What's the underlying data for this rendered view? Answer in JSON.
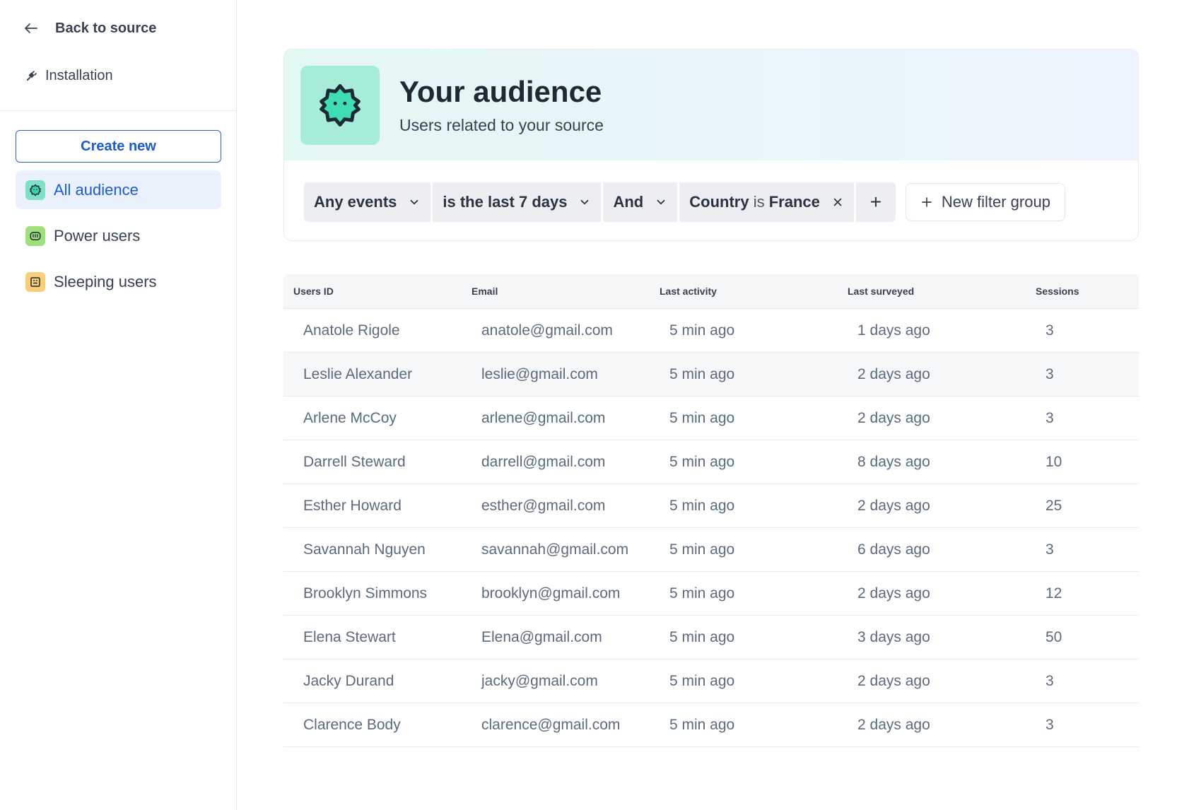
{
  "sidebar": {
    "back_label": "Back to source",
    "installation_label": "Installation",
    "create_label": "Create new",
    "items": [
      {
        "label": "All audience",
        "icon": "badge-icon",
        "color": "#7ee0c4"
      },
      {
        "label": "Power users",
        "icon": "face-icon",
        "color": "#9fe07d"
      },
      {
        "label": "Sleeping users",
        "icon": "box-icon",
        "color": "#f9cf7a"
      }
    ]
  },
  "header": {
    "title": "Your audience",
    "subtitle": "Users related to your source",
    "accent": "#a6ecd9"
  },
  "filters": {
    "events": "Any events",
    "period": "is the last 7 days",
    "operator": "And",
    "condition_field": "Country",
    "condition_op": "is",
    "condition_value": "France",
    "add_symbol": "+",
    "new_group_label": "New filter group"
  },
  "table": {
    "columns": [
      "Users ID",
      "Email",
      "Last activity",
      "Last surveyed",
      "Sessions"
    ],
    "rows": [
      [
        "Anatole Rigole",
        "anatole@gmail.com",
        "5 min ago",
        "1 days ago",
        "3"
      ],
      [
        "Leslie Alexander",
        "leslie@gmail.com",
        "5 min ago",
        "2 days ago",
        "3"
      ],
      [
        "Arlene McCoy",
        "arlene@gmail.com",
        "5 min ago",
        "2 days ago",
        "3"
      ],
      [
        "Darrell Steward",
        "darrell@gmail.com",
        "5 min ago",
        "8 days ago",
        "10"
      ],
      [
        "Esther Howard",
        "esther@gmail.com",
        "5 min ago",
        "2 days ago",
        "25"
      ],
      [
        "Savannah Nguyen",
        "savannah@gmail.com",
        "5 min ago",
        "6 days ago",
        "3"
      ],
      [
        "Brooklyn Simmons",
        "brooklyn@gmail.com",
        "5 min ago",
        "2 days ago",
        "12"
      ],
      [
        "Elena Stewart",
        "Elena@gmail.com",
        "5 min ago",
        "3 days ago",
        "50"
      ],
      [
        "Jacky Durand",
        "jacky@gmail.com",
        "5 min ago",
        "2 days ago",
        "3"
      ],
      [
        "Clarence Body",
        "clarence@gmail.com",
        "5 min ago",
        "2 days ago",
        "3"
      ]
    ]
  }
}
